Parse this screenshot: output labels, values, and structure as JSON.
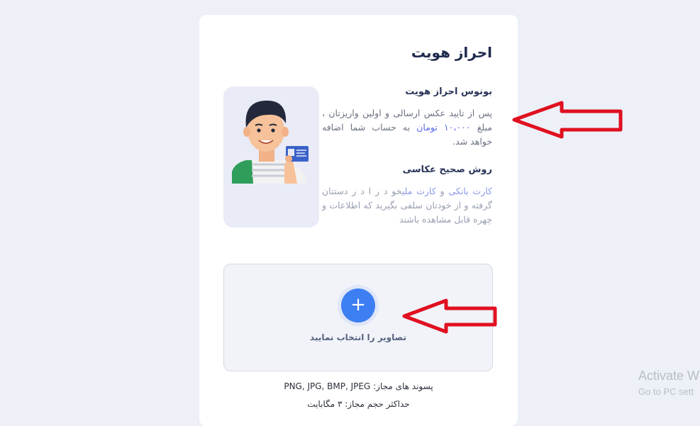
{
  "header": {
    "title": "احراز هویت"
  },
  "bonus": {
    "heading": "بونوس احراز هویت",
    "text_before": "پس از تایید عکس ارسالی و اولین واریزتان ، مبلغ ",
    "amount": "۱۰،۰۰۰ تومان",
    "text_after": " به حساب شما اضافه خواهد شد."
  },
  "photo_method": {
    "heading": "روش صحیح عکاسی",
    "bank_card": "کارت بانکی",
    "and": " و ",
    "national_card": "کارت ملی",
    "text": "خو د ر ا د ر دستتان گرفته و از خودتان سلفی بگیرید که اطلاعات و چهره قابل مشاهده باشند"
  },
  "upload": {
    "label": "تصاویر را انتخاب نمایید",
    "formats_label": "پسوند های مجاز:",
    "formats": "PNG, JPG, BMP, JPEG",
    "max_size": "حداکثر حجم مجاز: ۳ مگابایت"
  },
  "watermark": {
    "line1": "Activate W",
    "line2": "Go to PC sett"
  },
  "colors": {
    "accent": "#5a6be6",
    "upload_button": "#3d7ef2",
    "arrow": "#e01020"
  }
}
